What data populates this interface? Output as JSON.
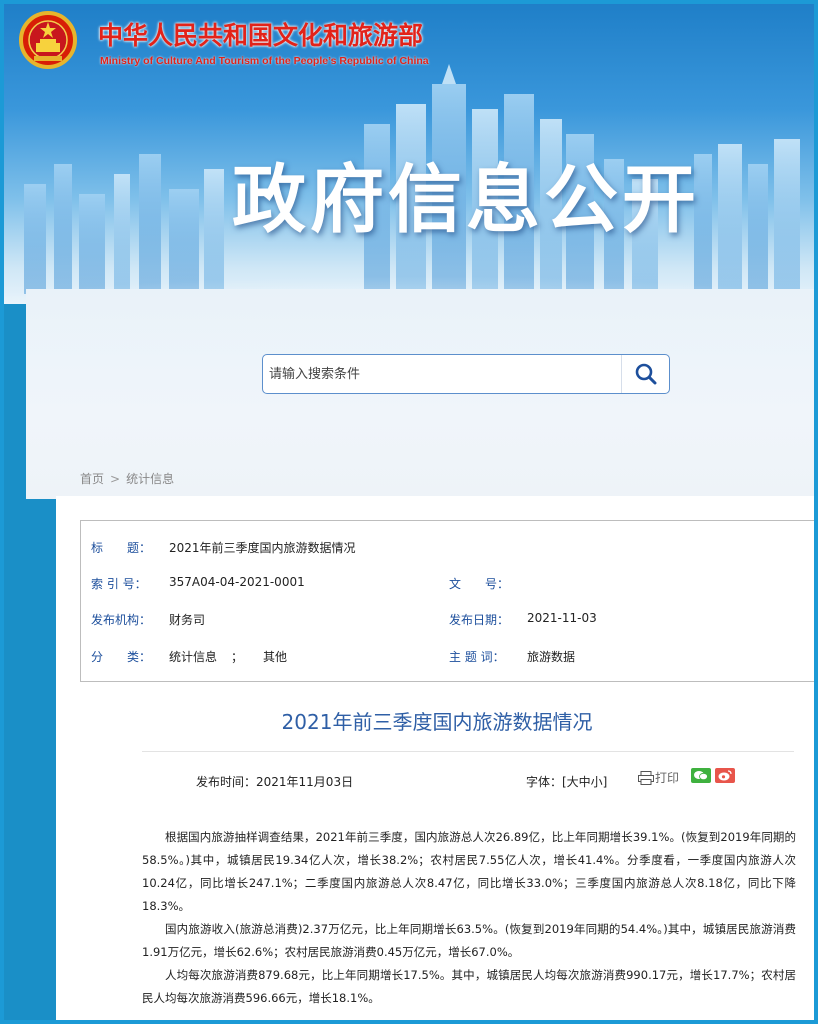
{
  "header": {
    "ministry_cn": "中华人民共和国文化和旅游部",
    "ministry_en": "Ministry of Culture And Tourism of the People’s Republic of China",
    "banner_title": "政府信息公开"
  },
  "search": {
    "placeholder": "请输入搜索条件"
  },
  "breadcrumb": {
    "home": "首页",
    "separator": ">",
    "current": "统计信息"
  },
  "meta": {
    "title_label": "标　　题：",
    "title_value": "2021年前三季度国内旅游数据情况",
    "index_label": "索 引 号：",
    "index_value": "357A04-04-2021-0001",
    "docno_label": "文　　号：",
    "docno_value": "",
    "org_label": "发布机构：",
    "org_value": "财务司",
    "date_label": "发布日期：",
    "date_value": "2021-11-03",
    "category_label": "分　　类：",
    "category_value1": "统计信息",
    "category_sep": "；",
    "category_value2": "其他",
    "topic_label": "主 题 词：",
    "topic_value": "旅游数据"
  },
  "article": {
    "title": "2021年前三季度国内旅游数据情况",
    "pub_time": "发布时间：2021年11月03日",
    "font_size_ctl": "字体：[大中小]",
    "print_label": "打印",
    "paragraphs": [
      "根据国内旅游抽样调查结果，2021年前三季度，国内旅游总人次26.89亿，比上年同期增长39.1%。(恢复到2019年同期的58.5%。)其中，城镇居民19.34亿人次，增长38.2%；农村居民7.55亿人次，增长41.4%。分季度看，一季度国内旅游人次10.24亿，同比增长247.1%；二季度国内旅游总人次8.47亿，同比增长33.0%；三季度国内旅游总人次8.18亿，同比下降18.3%。",
      "国内旅游收入(旅游总消费)2.37万亿元，比上年同期增长63.5%。(恢复到2019年同期的54.4%。)其中，城镇居民旅游消费1.91万亿元，增长62.6%；农村居民旅游消费0.45万亿元，增长67.0%。",
      "人均每次旅游消费879.68元，比上年同期增长17.5%。其中，城镇居民人均每次旅游消费990.17元，增长17.7%；农村居民人均每次旅游消费596.66元，增长18.1%。"
    ]
  },
  "colors": {
    "ministry_red": "#e2231a",
    "frame_blue": "#1c9ad6",
    "title_blue": "#2f5fa6",
    "label_blue": "#1d4f9c"
  },
  "icons": {
    "emblem": "national-emblem-icon",
    "search": "search-icon",
    "print": "printer-icon",
    "wechat": "wechat-icon",
    "weibo": "weibo-icon"
  }
}
